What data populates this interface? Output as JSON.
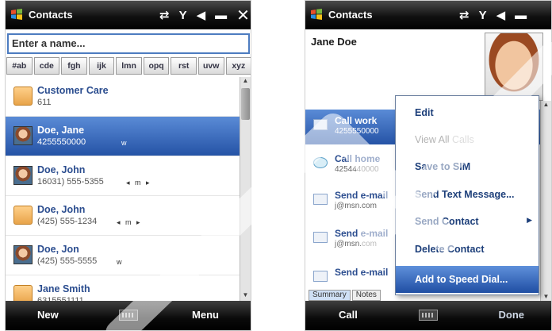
{
  "left": {
    "title": "Contacts",
    "search_placeholder": "Enter a name...",
    "letters": [
      "#ab",
      "cde",
      "fgh",
      "ijk",
      "lmn",
      "opq",
      "rst",
      "uvw",
      "xyz"
    ],
    "contacts": [
      {
        "name": "Customer Care",
        "phone": "611",
        "extra": ""
      },
      {
        "name": "Doe, Jane",
        "phone": "4255550000",
        "extra": "w"
      },
      {
        "name": "Doe, John",
        "phone": "16031) 555-5355",
        "extra": "◂ m ▸"
      },
      {
        "name": "Doe, John",
        "phone": "(425) 555-1234",
        "extra": "◂ m ▸"
      },
      {
        "name": "Doe, Jon",
        "phone": "(425) 555-5555",
        "extra": "w"
      },
      {
        "name": "Jane Smith",
        "phone": "6315551111",
        "extra": ""
      }
    ],
    "softkeys": {
      "left": "New",
      "right": "Menu"
    }
  },
  "right": {
    "title": "Contacts",
    "contact_name": "Jane Doe",
    "details": [
      {
        "line1": "Call work",
        "line2": "4255550000"
      },
      {
        "line1": "Call home",
        "line2": "4254440000"
      },
      {
        "line1": "Send e-mail",
        "line2": "j@msn.com"
      },
      {
        "line1": "Send e-mail",
        "line2": "j@msn.com"
      },
      {
        "line1": "Send e-mail",
        "line2": ""
      }
    ],
    "tabs": [
      "Summary",
      "Notes"
    ],
    "menu": [
      {
        "label": "Edit",
        "enabled": true
      },
      {
        "label": "View All Calls",
        "enabled": false
      },
      {
        "label": "Save to SIM",
        "enabled": true
      },
      {
        "label": "Send Text Message...",
        "enabled": true
      },
      {
        "label": "Send Contact",
        "enabled": true,
        "submenu": true
      },
      {
        "label": "Delete Contact",
        "enabled": true
      },
      {
        "label": "Add to Speed Dial...",
        "enabled": true,
        "highlighted": true
      }
    ],
    "softkeys": {
      "left": "Call",
      "right": "Done"
    }
  },
  "status_icons": [
    "connectivity-icon",
    "signal-icon",
    "volume-icon",
    "battery-icon"
  ],
  "colors": {
    "selection": "#2553a6",
    "titlebar": "#111111",
    "link": "#2b4d8f"
  }
}
